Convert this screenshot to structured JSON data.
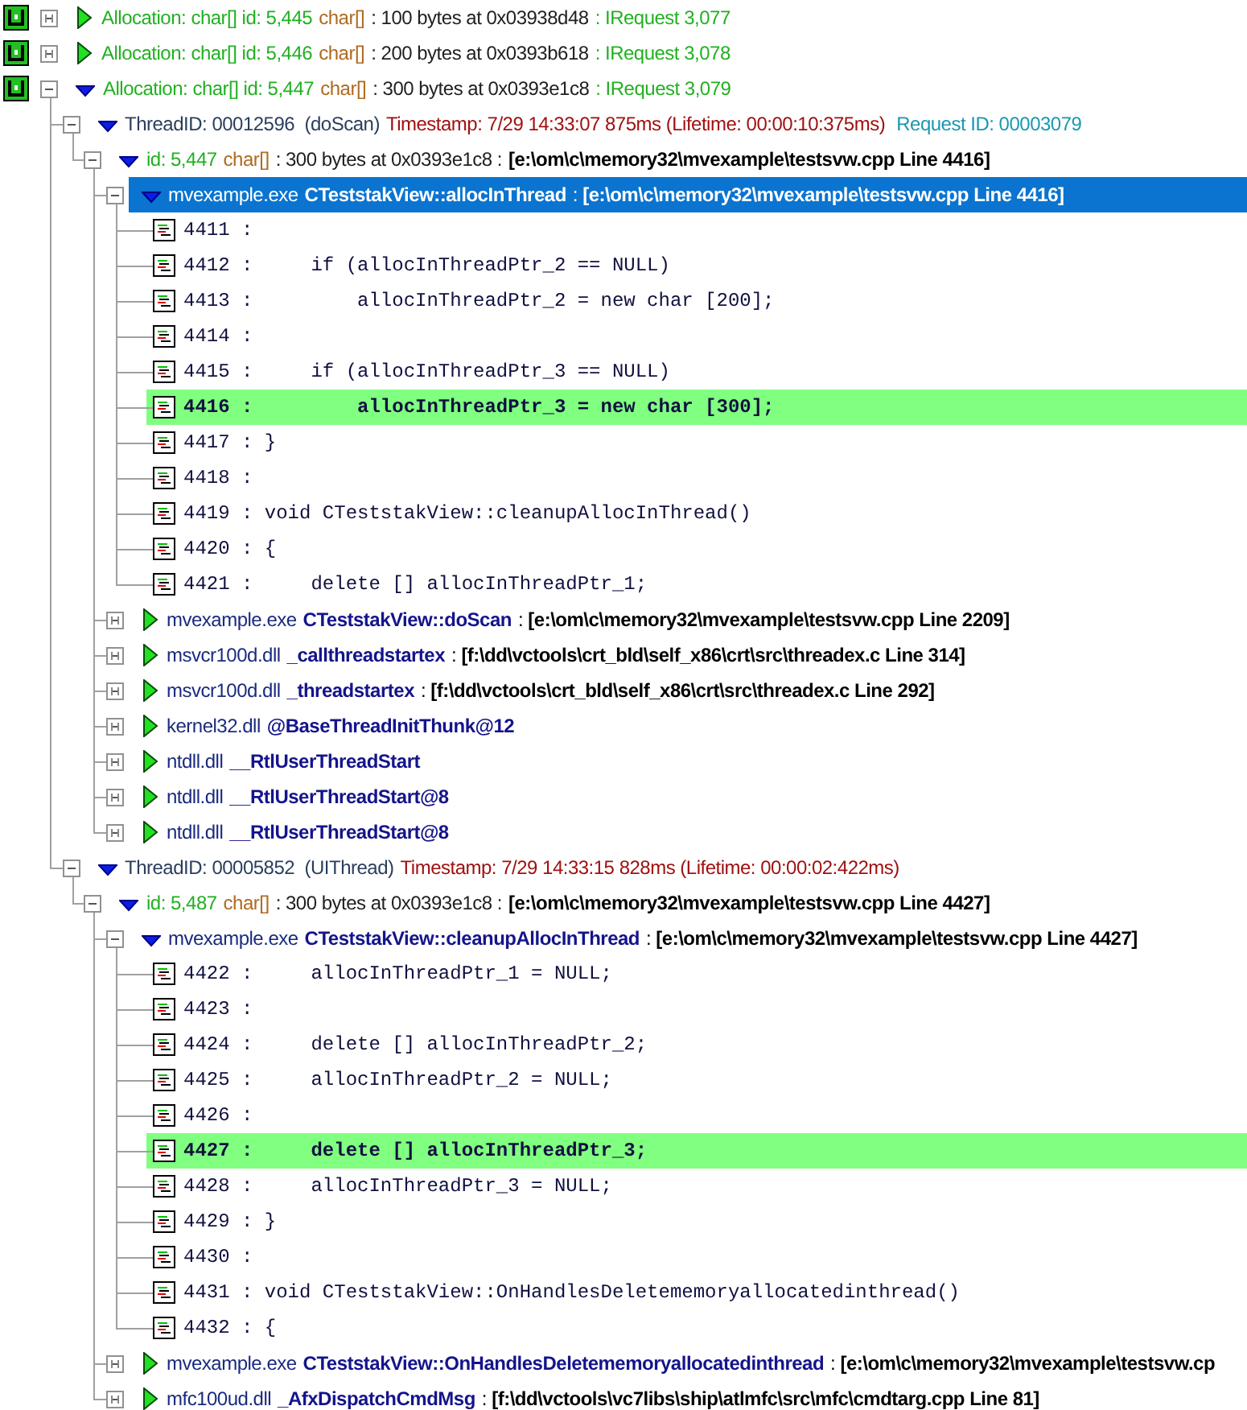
{
  "tree": [
    {
      "kind": "allocation",
      "expanded": false,
      "selected": false,
      "label": "Allocation: char[] id: 5,445",
      "type": "char[]",
      "size": ": 100 bytes at 0x03938d48",
      "request": ": IRequest 3,077"
    },
    {
      "kind": "allocation",
      "expanded": false,
      "selected": false,
      "label": "Allocation: char[] id: 5,446",
      "type": "char[]",
      "size": ": 200 bytes at 0x0393b618",
      "request": ": IRequest 3,078"
    },
    {
      "kind": "allocation",
      "expanded": true,
      "selected": false,
      "label": "Allocation: char[] id: 5,447",
      "type": "char[]",
      "size": ": 300 bytes at 0x0393e1c8",
      "request": ": IRequest 3,079",
      "children": [
        {
          "kind": "thread",
          "expanded": true,
          "selected": false,
          "thread": "ThreadID: 00012596  (doScan)",
          "timestamp": "Timestamp: 7/29 14:33:07 875ms (Lifetime: 00:00:10:375ms)",
          "request": "Request ID: 00003079",
          "children": [
            {
              "kind": "allocation_id",
              "expanded": true,
              "selected": false,
              "id": "id: 5,447",
              "type": "char[]",
              "size": ": 300 bytes at 0x0393e1c8 :",
              "location": "[e:\\om\\c\\memory32\\mvexample\\testsvw.cpp Line 4416]",
              "children": [
                {
                  "kind": "frame",
                  "expanded": true,
                  "selected": true,
                  "module": "mvexample.exe",
                  "function": "CTeststakView::allocInThread",
                  "location": ": **[e:\\om\\c\\memory32\\mvexample\\testsvw.cpp Line 4416]**",
                  "children": [
                    {
                      "kind": "source",
                      "selected": false,
                      "highlighted": false,
                      "text": "4411 :"
                    },
                    {
                      "kind": "source",
                      "selected": false,
                      "highlighted": false,
                      "text": "4412 :     if (allocInThreadPtr_2 == NULL)"
                    },
                    {
                      "kind": "source",
                      "selected": false,
                      "highlighted": false,
                      "text": "4413 :         allocInThreadPtr_2 = new char [200];"
                    },
                    {
                      "kind": "source",
                      "selected": false,
                      "highlighted": false,
                      "text": "4414 :"
                    },
                    {
                      "kind": "source",
                      "selected": false,
                      "highlighted": false,
                      "text": "4415 :     if (allocInThreadPtr_3 == NULL)"
                    },
                    {
                      "kind": "source",
                      "selected": false,
                      "highlighted": true,
                      "text": "4416 :         allocInThreadPtr_3 = new char [300];"
                    },
                    {
                      "kind": "source",
                      "selected": false,
                      "highlighted": false,
                      "text": "4417 : }"
                    },
                    {
                      "kind": "source",
                      "selected": false,
                      "highlighted": false,
                      "text": "4418 :"
                    },
                    {
                      "kind": "source",
                      "selected": false,
                      "highlighted": false,
                      "text": "4419 : void CTeststakView::cleanupAllocInThread()"
                    },
                    {
                      "kind": "source",
                      "selected": false,
                      "highlighted": false,
                      "text": "4420 : {"
                    },
                    {
                      "kind": "source",
                      "selected": false,
                      "highlighted": false,
                      "text": "4421 :     delete [] allocInThreadPtr_1;"
                    }
                  ]
                },
                {
                  "kind": "frame",
                  "expanded": false,
                  "selected": false,
                  "module": "mvexample.exe",
                  "function": "CTeststakView::doScan",
                  "location": ": **[e:\\om\\c\\memory32\\mvexample\\testsvw.cpp Line 2209]**"
                },
                {
                  "kind": "frame",
                  "expanded": false,
                  "selected": false,
                  "module": "msvcr100d.dll",
                  "function": "_callthreadstartex",
                  "location": ": **[f:\\dd\\vctools\\crt_bld\\self_x86\\crt\\src\\threadex.c Line 314]**"
                },
                {
                  "kind": "frame",
                  "expanded": false,
                  "selected": false,
                  "module": "msvcr100d.dll",
                  "function": "_threadstartex",
                  "location": ": **[f:\\dd\\vctools\\crt_bld\\self_x86\\crt\\src\\threadex.c Line 292]**"
                },
                {
                  "kind": "frame",
                  "expanded": false,
                  "selected": false,
                  "module": "kernel32.dll",
                  "function": "@BaseThreadInitThunk@12"
                },
                {
                  "kind": "frame",
                  "expanded": false,
                  "selected": false,
                  "module": "ntdll.dll",
                  "function": "__RtlUserThreadStart"
                },
                {
                  "kind": "frame",
                  "expanded": false,
                  "selected": false,
                  "module": "ntdll.dll",
                  "function": "__RtlUserThreadStart@8"
                },
                {
                  "kind": "frame",
                  "expanded": false,
                  "selected": false,
                  "module": "ntdll.dll",
                  "function": "__RtlUserThreadStart@8"
                }
              ]
            }
          ]
        },
        {
          "kind": "thread",
          "expanded": true,
          "selected": false,
          "thread": "ThreadID: 00005852  (UIThread)",
          "timestamp": "Timestamp: 7/29 14:33:15 828ms (Lifetime: 00:00:02:422ms)",
          "children": [
            {
              "kind": "allocation_id",
              "expanded": true,
              "selected": false,
              "id": "id: 5,487",
              "type": "char[]",
              "size": ": 300 bytes at 0x0393e1c8 :",
              "location": "[e:\\om\\c\\memory32\\mvexample\\testsvw.cpp Line 4427]",
              "children": [
                {
                  "kind": "frame",
                  "expanded": true,
                  "selected": false,
                  "module": "mvexample.exe",
                  "function": "CTeststakView::cleanupAllocInThread",
                  "location": ": **[e:\\om\\c\\memory32\\mvexample\\testsvw.cpp Line 4427]**",
                  "children": [
                    {
                      "kind": "source",
                      "selected": false,
                      "highlighted": false,
                      "text": "4422 :     allocInThreadPtr_1 = NULL;"
                    },
                    {
                      "kind": "source",
                      "selected": false,
                      "highlighted": false,
                      "text": "4423 :"
                    },
                    {
                      "kind": "source",
                      "selected": false,
                      "highlighted": false,
                      "text": "4424 :     delete [] allocInThreadPtr_2;"
                    },
                    {
                      "kind": "source",
                      "selected": false,
                      "highlighted": false,
                      "text": "4425 :     allocInThreadPtr_2 = NULL;"
                    },
                    {
                      "kind": "source",
                      "selected": false,
                      "highlighted": false,
                      "text": "4426 :"
                    },
                    {
                      "kind": "source",
                      "selected": false,
                      "highlighted": true,
                      "text": "4427 :     delete [] allocInThreadPtr_3;"
                    },
                    {
                      "kind": "source",
                      "selected": false,
                      "highlighted": false,
                      "text": "4428 :     allocInThreadPtr_3 = NULL;"
                    },
                    {
                      "kind": "source",
                      "selected": false,
                      "highlighted": false,
                      "text": "4429 : }"
                    },
                    {
                      "kind": "source",
                      "selected": false,
                      "highlighted": false,
                      "text": "4430 :"
                    },
                    {
                      "kind": "source",
                      "selected": false,
                      "highlighted": false,
                      "text": "4431 : void CTeststakView::OnHandlesDeletememoryallocatedinthread()"
                    },
                    {
                      "kind": "source",
                      "selected": false,
                      "highlighted": false,
                      "text": "4432 : {"
                    }
                  ]
                },
                {
                  "kind": "frame",
                  "expanded": false,
                  "selected": false,
                  "module": "mvexample.exe",
                  "function": "CTeststakView::OnHandlesDeletememoryallocatedinthread",
                  "location": ": **[e:\\om\\c\\memory32\\mvexample\\testsvw.cp**"
                },
                {
                  "kind": "frame",
                  "expanded": false,
                  "selected": false,
                  "module": "mfc100ud.dll",
                  "function": "_AfxDispatchCmdMsg",
                  "location": ": **[f:\\dd\\vctools\\vc7libs\\ship\\atlmfc\\src\\mfc\\cmdtarg.cpp Line 81]**"
                }
              ]
            }
          ]
        }
      ]
    }
  ]
}
